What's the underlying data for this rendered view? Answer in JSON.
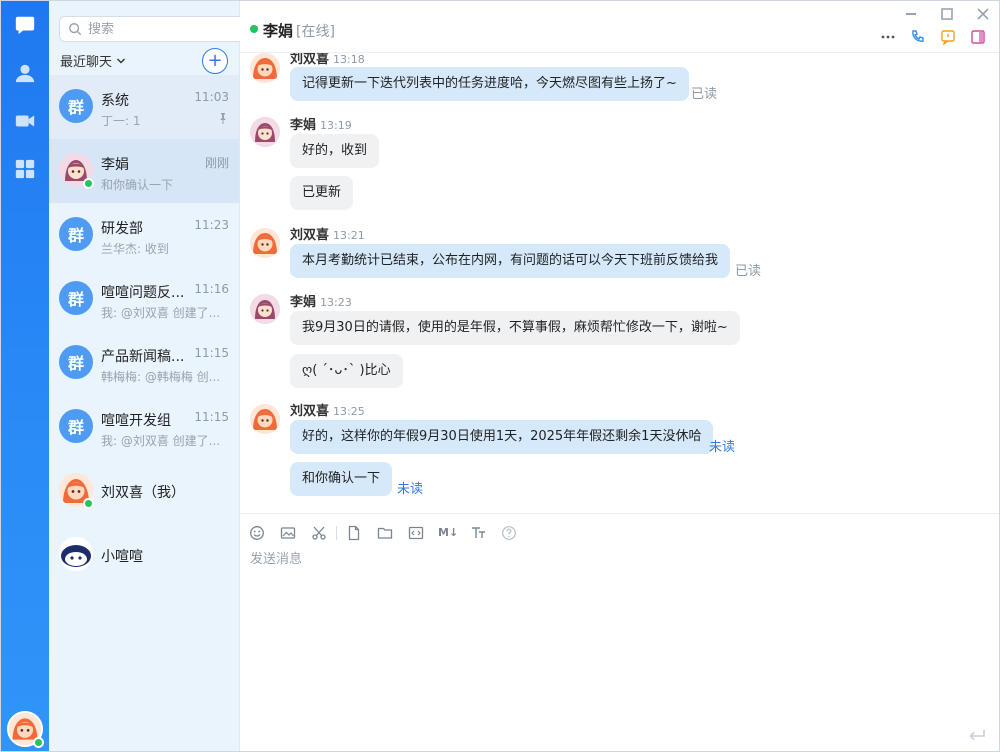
{
  "search": {
    "placeholder": "搜索"
  },
  "list": {
    "recent_label": "最近聊天",
    "add_label": "+",
    "group_avatar_text": "群",
    "conversations": [
      {
        "name": "系统",
        "time": "11:03",
        "preview": "丁一: 1",
        "pinned": true
      },
      {
        "name": "李娟",
        "time": "刚刚",
        "preview": "和你确认一下",
        "online": true
      },
      {
        "name": "研发部",
        "time": "11:23",
        "preview": "兰华杰: 收到"
      },
      {
        "name": "喧喧问题反...",
        "time": "11:16",
        "preview": "我: @刘双喜 创建了..."
      },
      {
        "name": "产品新闻稿...",
        "time": "11:15",
        "preview": "韩梅梅: @韩梅梅 创..."
      },
      {
        "name": "喧喧开发组",
        "time": "11:15",
        "preview": "我: @刘双喜 创建了..."
      },
      {
        "name": "刘双喜（我）",
        "online": true
      },
      {
        "name": "小喧喧"
      }
    ]
  },
  "header": {
    "title": "李娟",
    "status": "[在线]"
  },
  "messages": [
    {
      "sender": "刘双喜",
      "time": "13:18",
      "text": "记得更新一下迭代列表中的任务进度哈，今天燃尽图有些上扬了~",
      "state": "已读"
    },
    {
      "sender": "李娟",
      "time": "13:19",
      "text": "好的，收到"
    },
    {
      "text": "已更新"
    },
    {
      "sender": "刘双喜",
      "time": "13:21",
      "text": "本月考勤统计已结束，公布在内网，有问题的话可以今天下班前反馈给我",
      "state": "已读"
    },
    {
      "sender": "李娟",
      "time": "13:23",
      "text": "我9月30日的请假，使用的是年假，不算事假，麻烦帮忙修改一下，谢啦~"
    },
    {
      "text": "ღ( ´･ᴗ･` )比心"
    },
    {
      "sender": "刘双喜",
      "time": "13:25",
      "text": "好的，这样你的年假9月30日使用1天，2025年年假还剩余1天没休哈",
      "state": "未读"
    },
    {
      "text": "和你确认一下",
      "state": "未读"
    }
  ],
  "compose": {
    "placeholder": "发送消息"
  },
  "toolbar": {
    "markdown_label": "M↓"
  },
  "colors": {
    "rail": "#1f78f0",
    "accent": "#2f7be5",
    "bubble_me": "#d5e9fb",
    "bubble_other": "#f0f1f3",
    "online": "#22c55e",
    "list_bg": "#eaf4fd"
  }
}
